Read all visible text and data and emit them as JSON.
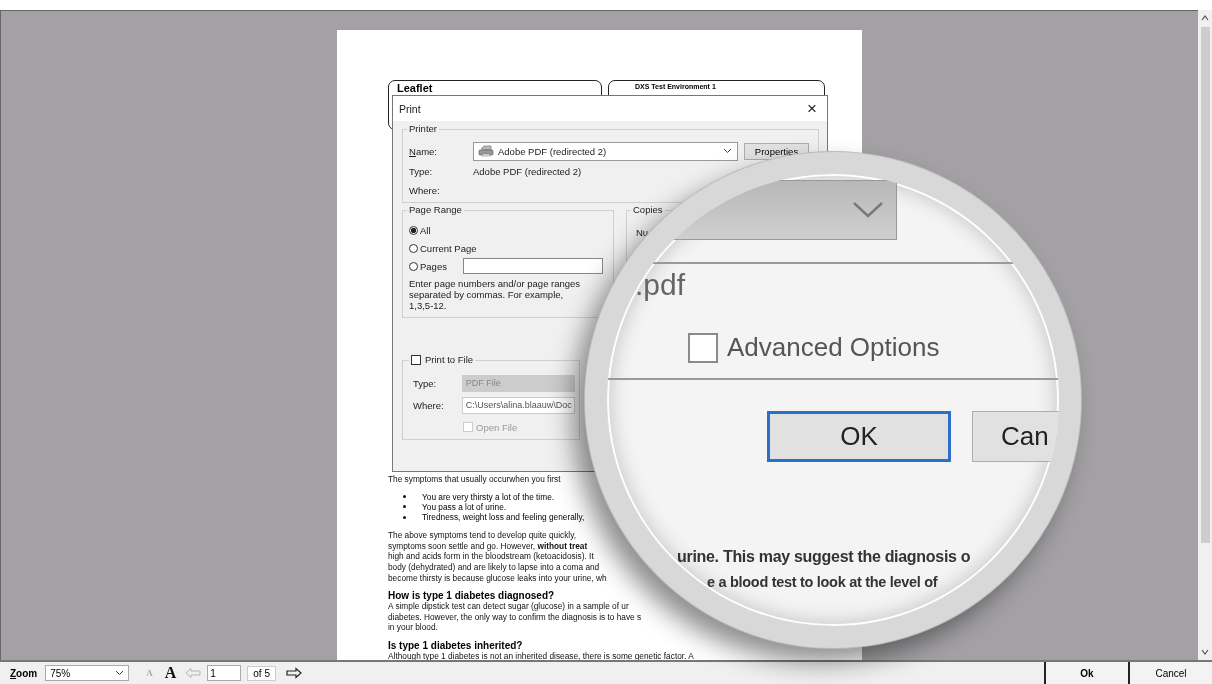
{
  "document": {
    "header_left": "Leaflet",
    "header_right": "DXS Test Environment 1",
    "blocks": [
      {
        "kind": "lines",
        "lines": [
          "The symptoms that usually occurwhen you first"
        ]
      },
      {
        "kind": "bullets",
        "items": [
          "You are very thirsty a lot of the time.",
          "You pass a lot of urine.",
          "Tiredness, weight loss and feeling generally,"
        ]
      },
      {
        "kind": "lines",
        "lines": [
          "The above symptoms tend to develop quite quickly,",
          "symptoms soon settle and go. However, **without treat**",
          "high and acids form in the bloodstream (ketoacidosis). It",
          "body (dehydrated) and are likely to lapse into a coma and",
          "become thirsty is because glucose leaks into your urine, wh"
        ]
      },
      {
        "kind": "heading",
        "text": "How is type 1 diabetes diagnosed?"
      },
      {
        "kind": "lines",
        "lines": [
          "A simple dipstick test can detect sugar (glucose) in a sample of ur",
          "diabetes. However, the only way to confirm the diagnosis is to have s",
          "in your blood."
        ]
      },
      {
        "kind": "heading",
        "text": "Is type 1 diabetes inherited?"
      },
      {
        "kind": "lines",
        "lines": [
          "Although type 1 diabetes is not an inherited disease, there is some genetic factor. A"
        ]
      }
    ]
  },
  "print_dialog": {
    "title": "Print",
    "close": "×",
    "printer": {
      "legend": "Printer",
      "name_label": "Name:",
      "name_value": "Adobe PDF (redirected 2)",
      "properties": "Properties",
      "type_label": "Type:",
      "type_value": "Adobe PDF (redirected 2)",
      "where_label": "Where:"
    },
    "page_range": {
      "legend": "Page Range",
      "options": [
        {
          "label": "All",
          "selected": true
        },
        {
          "label": "Current Page",
          "selected": false
        },
        {
          "label": "Pages",
          "selected": false
        }
      ],
      "help": [
        "Enter page numbers and/or page ranges",
        "separated by commas.  For example,",
        "1,3,5-12."
      ]
    },
    "copies": {
      "legend": "Copies",
      "number_label": "Nu"
    },
    "print_to_file": {
      "label": "Print to File",
      "checked": false,
      "type_label": "Type:",
      "type_value": "PDF File",
      "where_label": "Where:",
      "where_value": "C:\\Users\\alina.blaauw\\Doc",
      "open_file": {
        "label": "Open File",
        "checked": false,
        "disabled": true
      }
    }
  },
  "magnifier": {
    "file_suffix": ".pdf",
    "advanced_options": {
      "label": "Advanced Options",
      "checked": false
    },
    "buttons": [
      {
        "label": "OK",
        "focused": true
      },
      {
        "label": "Can",
        "focused": false
      }
    ],
    "text_lines": [
      "urine. This may suggest the diagnosis o",
      "e a blood test to look at the level of"
    ]
  },
  "toolbar": {
    "zoom_label": "Zoom",
    "zoom_value": "75%",
    "font_smaller": "A",
    "font_larger": "A",
    "prev_disabled": true,
    "page_value": "1",
    "page_count": "of 5",
    "buttons": [
      {
        "label": "Ok",
        "default": true
      },
      {
        "label": "Cancel",
        "default": false
      }
    ]
  }
}
